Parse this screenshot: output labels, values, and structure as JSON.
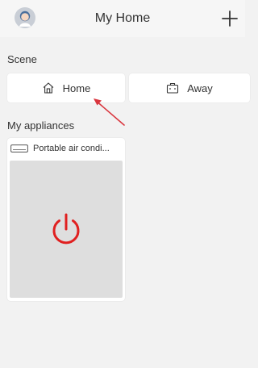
{
  "header": {
    "title": "My Home",
    "avatar_icon": "user-avatar-icon",
    "add_icon": "plus-icon"
  },
  "scene": {
    "label": "Scene",
    "items": [
      {
        "label": "Home",
        "icon": "home-icon"
      },
      {
        "label": "Away",
        "icon": "suitcase-icon"
      }
    ]
  },
  "appliances": {
    "label": "My appliances",
    "items": [
      {
        "name": "Portable air condi...",
        "icon": "air-conditioner-icon",
        "power_icon": "power-icon",
        "power_state": "off"
      }
    ]
  },
  "colors": {
    "background": "#f2f2f2",
    "card": "#ffffff",
    "appliance_body": "#dedede",
    "power_red": "#e02020",
    "annotation_arrow": "#d9363e"
  }
}
